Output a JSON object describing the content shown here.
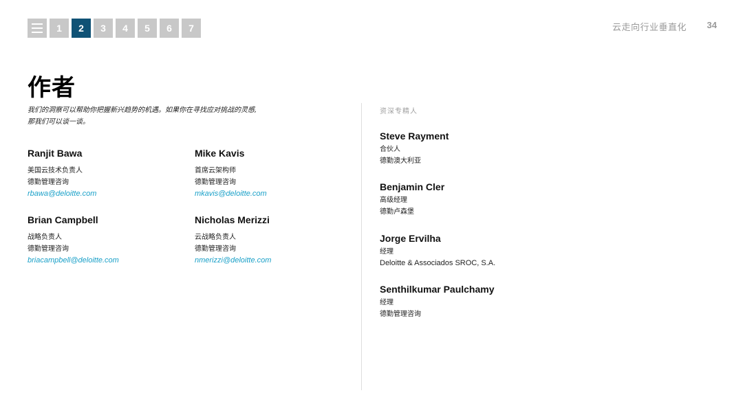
{
  "nav": {
    "menu_icon": "menu-icon",
    "items": [
      "1",
      "2",
      "3",
      "4",
      "5",
      "6",
      "7"
    ],
    "active": "2"
  },
  "header": {
    "title": "云走向行业垂直化",
    "page_number": "34"
  },
  "title": "作者",
  "intro": {
    "line1": "我们的洞察可以帮助你把握新兴趋势的机遇。如果你在寻找应对挑战的灵感,",
    "line2": "那我们可以谈一谈。"
  },
  "authors": [
    {
      "name": "Ranjit Bawa",
      "role": "美国云技术负责人",
      "org": "德勤管理咨询",
      "email": "rbawa@deloitte.com"
    },
    {
      "name": "Mike Kavis",
      "role": "首席云架构师",
      "org": "德勤管理咨询",
      "email": "mkavis@deloitte.com"
    },
    {
      "name": "Brian Campbell",
      "role": "战略负责人",
      "org": "德勤管理咨询",
      "email": "briacampbell@deloitte.com"
    },
    {
      "name": "Nicholas Merizzi",
      "role": "云战略负责人",
      "org": "德勤管理咨询",
      "email": "nmerizzi@deloitte.com"
    }
  ],
  "experts": {
    "label": "资深专精人",
    "items": [
      {
        "name": "Steve Rayment",
        "role": "合伙人",
        "org": "德勤澳大利亚"
      },
      {
        "name": "Benjamin Cler",
        "role": "高级经理",
        "org": "德勤卢森堡"
      },
      {
        "name": "Jorge Ervilha",
        "role": "经理",
        "org": "Deloitte & Associados SROC, S.A."
      },
      {
        "name": "Senthilkumar Paulchamy",
        "role": "经理",
        "org": "德勤管理咨询"
      }
    ]
  },
  "colors": {
    "nav_active": "#0f5275",
    "nav_inactive": "#c8c8c8",
    "email_link": "#1aa0c8"
  }
}
